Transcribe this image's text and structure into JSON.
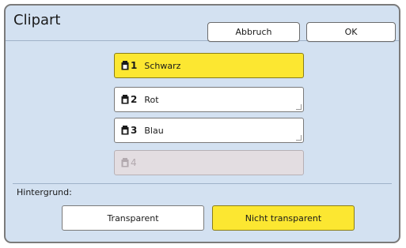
{
  "dialog": {
    "title": "Clipart",
    "cancel_label": "Abbruch",
    "ok_label": "OK"
  },
  "colors": [
    {
      "number": "1",
      "label": "Schwarz",
      "state": "selected"
    },
    {
      "number": "2",
      "label": "Rot",
      "state": "normal"
    },
    {
      "number": "3",
      "label": "Blau",
      "state": "normal"
    },
    {
      "number": "4",
      "label": "",
      "state": "disabled"
    }
  ],
  "background": {
    "label": "Hintergrund:",
    "transparent_label": "Transparent",
    "opaque_label": "Nicht transparent",
    "selected": "opaque"
  },
  "theme": {
    "panel": "#d3e1f1",
    "selected": "#fce731",
    "disabled": "#e3dde1"
  },
  "icons": {
    "ink": "ink-cartridge-icon"
  }
}
